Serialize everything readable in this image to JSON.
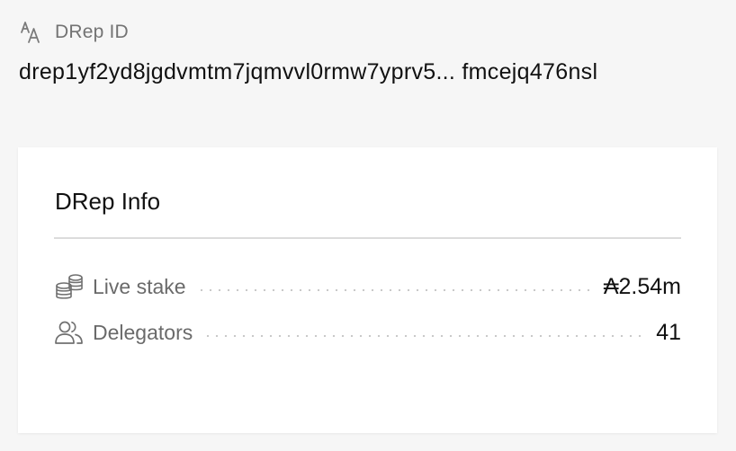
{
  "header": {
    "icon": "font-size-icon",
    "label": "DRep ID",
    "id_value": "drep1yf2yd8jgdvmtm7jqmvvl0rmw7yprv5... fmcejq476nsl"
  },
  "card": {
    "title": "DRep Info",
    "rows": [
      {
        "icon": "coins-icon",
        "label": "Live stake",
        "value": "₳2.54m"
      },
      {
        "icon": "users-icon",
        "label": "Delegators",
        "value": "41"
      }
    ]
  },
  "colors": {
    "page_background": "#f6f6f6",
    "card_background": "#ffffff",
    "muted_text": "#6a6a6a",
    "divider": "#dcdcdc"
  }
}
